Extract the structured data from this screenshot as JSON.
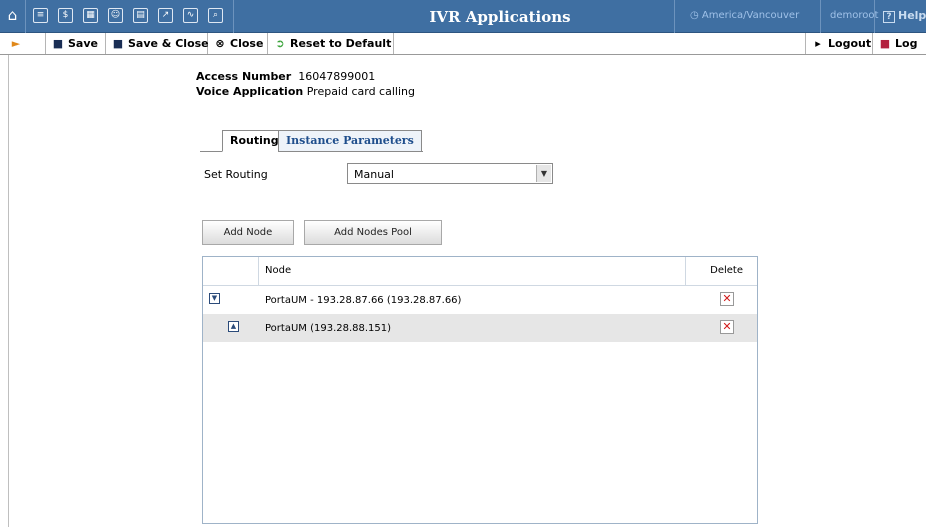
{
  "topbar": {
    "title": "IVR Applications",
    "timezone": "America/Vancouver",
    "user": "demoroot",
    "help": "Help",
    "nav_icons": [
      "home-icon",
      "list-icon",
      "dollar-icon",
      "grid-icon",
      "person-icon",
      "server-icon",
      "export-icon",
      "chart-icon",
      "search-icon"
    ]
  },
  "toolbar": {
    "save": "Save",
    "save_close": "Save & Close",
    "close": "Close",
    "reset": "Reset to Default",
    "logout": "Logout",
    "log": "Log"
  },
  "info": {
    "access_number_label": "Access Number",
    "access_number": "16047899001",
    "voice_app_label": "Voice Application",
    "voice_app": "Prepaid card calling"
  },
  "tabs": [
    {
      "label": "Routing",
      "active": true
    },
    {
      "label": "Instance Parameters",
      "active": false
    }
  ],
  "routing": {
    "label": "Set Routing",
    "selected": "Manual"
  },
  "buttons": {
    "add_node": "Add Node",
    "add_nodes_pool": "Add Nodes Pool"
  },
  "table": {
    "columns": [
      "Node",
      "Delete"
    ],
    "rows": [
      {
        "label": "PortaUM - 193.28.87.66 (193.28.87.66)",
        "toggle": "collapse",
        "level": 0
      },
      {
        "label": "PortaUM (193.28.88.151)",
        "toggle": "expand",
        "level": 1
      }
    ]
  },
  "colors": {
    "topbar": "#3f6fa2",
    "tab_link": "#1f4e8c",
    "delete": "#d11a1a"
  }
}
